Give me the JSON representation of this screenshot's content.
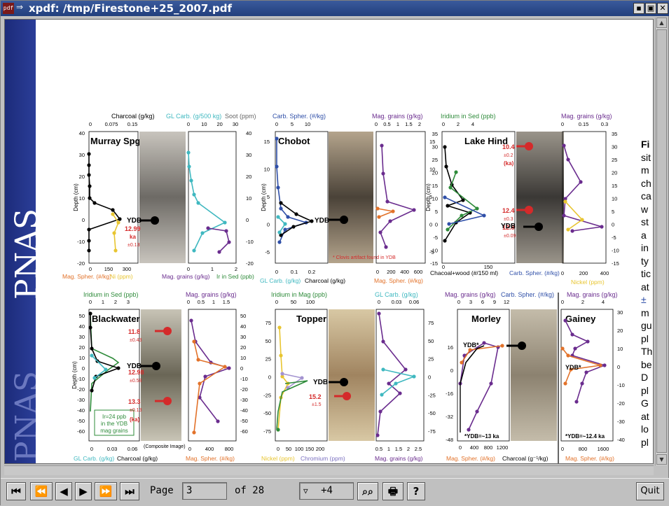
{
  "window": {
    "title": "xpdf: /tmp/Firestone+25_2007.pdf",
    "app_icon": "pdf",
    "buttons": {
      "iconify": "▪",
      "maximize": "▣",
      "close": "✕"
    }
  },
  "document": {
    "band_text_top": "PNAS",
    "band_text_bottom": "PNAS",
    "right_fragments": [
      "Fi",
      "sit",
      "m",
      "ch",
      "ca",
      "w",
      "st",
      "a",
      "in",
      "ty",
      "tic",
      "at",
      "±",
      "m",
      "gu",
      "pl",
      "Th",
      "be",
      "D",
      "pl",
      "G",
      "at",
      "lo",
      "pl"
    ],
    "panels": [
      {
        "name": "Murray Spgs",
        "top_axes": [
          "Charcoal (g/kg)",
          "GL Carb. (g/500 kg)",
          "Soot (ppm)"
        ],
        "top_ticks1": [
          "0",
          "0.075",
          "0.15"
        ],
        "top_ticks2": [
          "0",
          "10",
          "20",
          "30"
        ],
        "bottom_axes": [
          "Mag. Spher. (#/kg)",
          "Ni (ppm)",
          "Mag. grains (g/kg)",
          "Ir in Sed (ppb)"
        ],
        "bottom_ticks1": [
          "0",
          "150",
          "300"
        ],
        "bottom_ticks2": [
          "0",
          "1",
          "2"
        ],
        "left_ticks": [
          "40",
          "30",
          "20",
          "10",
          "0",
          "-10",
          "-20"
        ],
        "right_ticks": [
          "40",
          "30",
          "20",
          "10",
          "0",
          "-10",
          "-20"
        ],
        "ydb": "YDB",
        "age": "12.99",
        "age2": "ka",
        "age_err": "±0.13",
        "ylabel": "Depth (cm)"
      },
      {
        "name": "Chobot",
        "top_axes": [
          "Carb. Spher. (#/kg)",
          "Mag. grains (g/kg)"
        ],
        "top_ticks1": [
          "0",
          "5",
          "10"
        ],
        "top_ticks2": [
          "0",
          "0.5",
          "1",
          "1.5",
          "2"
        ],
        "bottom_axes": [
          "GL Carb. (g/kg)",
          "Charcoal (g/kg)",
          "Mag. Spher. (#/kg)"
        ],
        "bottom_ticks1": [
          "0",
          "0.1",
          "0.2"
        ],
        "bottom_ticks2": [
          "0",
          "200",
          "400",
          "600"
        ],
        "left_ticks": [
          "15",
          "10",
          "5",
          "0",
          "-5"
        ],
        "right_ticks": [
          "15",
          "10",
          "5",
          "0",
          "-5"
        ],
        "ydb": "YDB",
        "note": "Clovis artifact found in YDB",
        "ylabel": "Depth (cm)"
      },
      {
        "name": "Lake Hind",
        "top_axes": [
          "Iridium in Sed (ppb)",
          "Mag. grains (g/kg)"
        ],
        "top_ticks1": [
          "0",
          "2",
          "4"
        ],
        "top_ticks2": [
          "0",
          "0.15",
          "0.3"
        ],
        "bottom_axes": [
          "Chacoal+wood (#/150 ml)",
          "Carb. Spher. (#/kg)",
          "Nickel (ppm)"
        ],
        "bottom_ticks1": [
          "0",
          "150"
        ],
        "bottom_ticks2": [
          "0",
          "200",
          "400"
        ],
        "left_ticks": [
          "35",
          "30",
          "25",
          "20",
          "15",
          "10",
          "5",
          "0",
          "-5",
          "-10",
          "-15"
        ],
        "right_ticks": [
          "35",
          "30",
          "25",
          "20",
          "15",
          "10",
          "5",
          "0",
          "-5",
          "-10",
          "-15"
        ],
        "ydb": "YDB",
        "ages": [
          {
            "v": "10.4",
            "e": "±0.2",
            "u": "(ka)"
          },
          {
            "v": "12.4",
            "e": "±0.3",
            "u": ""
          },
          {
            "v": "12.8",
            "e": "±0.09",
            "u": ""
          }
        ],
        "ylabel": "Depth (cm)"
      },
      {
        "name": "Blackwater",
        "top_axes": [
          "Iridium in Sed (ppb)",
          "Mag. grains (g/kg)"
        ],
        "top_ticks1": [
          "0",
          "1",
          "2",
          "3"
        ],
        "top_ticks2": [
          "0",
          "0.5",
          "1",
          "1.5"
        ],
        "bottom_axes": [
          "GL Carb. (g/kg)",
          "Charcoal (g/kg)",
          "Mag. Spher. (#/kg)"
        ],
        "bottom_ticks1": [
          "0",
          "0.03",
          "0.06"
        ],
        "bottom_ticks2": [
          "0",
          "400",
          "800"
        ],
        "left_ticks": [
          "50",
          "40",
          "30",
          "20",
          "10",
          "0",
          "-10",
          "-20",
          "-30",
          "-40",
          "-50",
          "-60"
        ],
        "right_ticks": [
          "50",
          "40",
          "30",
          "20",
          "10",
          "0",
          "-10",
          "-20",
          "-30",
          "-40",
          "-50",
          "-60"
        ],
        "ydb": "YDB",
        "ages": [
          {
            "v": "11.8",
            "e": "±0.43"
          },
          {
            "v": "12.98",
            "e": "±0.58"
          },
          {
            "v": "13.3",
            "e": "±0.13"
          }
        ],
        "age_unit": "(ka)",
        "box": [
          "Ir=24 ppb",
          "in the YDB",
          "mag grains"
        ],
        "caption": "(Composite Image)",
        "ylabel": "Depth (cm)"
      },
      {
        "name": "Topper",
        "top_axes": [
          "Iridium in Mag (ppb)",
          "GL Carb. (g/kg)"
        ],
        "top_ticks1": [
          "0",
          "50",
          "100"
        ],
        "top_ticks2": [
          "0",
          "0.03",
          "0.06"
        ],
        "bottom_axes": [
          "Nickel (ppm)",
          "Chromium (ppm)",
          "Mag. grains (g/kg)"
        ],
        "bottom_ticks1": [
          "0",
          "50",
          "100",
          "150",
          "200"
        ],
        "bottom_ticks2": [
          "0.5",
          "1",
          "1.5",
          "2",
          "2.5"
        ],
        "left_ticks": [
          "75",
          "50",
          "25",
          "0",
          "-25",
          "-50",
          "-75"
        ],
        "right_ticks": [
          "75",
          "50",
          "25",
          "0",
          "-25",
          "-50",
          "-75"
        ],
        "ydb": "YDB",
        "age": "15.2",
        "age_err": "±1.5"
      },
      {
        "name": "Morley",
        "top_axes": [
          "Mag. grains (g/kg)",
          "Carb. Spher. (#/kg)"
        ],
        "top_ticks1": [
          "0",
          "3",
          "6",
          "9",
          "12"
        ],
        "bottom_axes": [
          "Mag. Spher. (#/kg)",
          "Charcoal (g⁻¹/kg)"
        ],
        "bottom_ticks1": [
          "0",
          "400",
          "800",
          "1200"
        ],
        "left_ticks": [
          "16",
          "0",
          "-16",
          "-32",
          "-48"
        ],
        "ydb": "YDB*",
        "note": "*YDB=~13 ka"
      },
      {
        "name": "Gainey",
        "top_axes": [
          "Mag. grains (g/kg)"
        ],
        "top_ticks1": [
          "0",
          "2",
          "4"
        ],
        "bottom_axes": [
          "Mag. Spher. (#/kg)"
        ],
        "bottom_ticks1": [
          "0",
          "800",
          "1600"
        ],
        "right_ticks": [
          "30",
          "20",
          "10",
          "0",
          "-10",
          "-20",
          "-30",
          "-40"
        ],
        "ydb": "YDB*",
        "note": "*YDB=~12.4 ka"
      }
    ]
  },
  "toolbar": {
    "first_label": "⏮",
    "back5_label": "⏪",
    "prev_label": "◀",
    "next_label": "▶",
    "fwd5_label": "⏩",
    "last_label": "⏭",
    "page_label": "Page",
    "page_value": "3",
    "of_label": "of 28",
    "zoom_value": "+4",
    "find_label": "🔍",
    "print_label": "🖶",
    "help_label": "?",
    "quit_label": "Quit"
  },
  "colors": {
    "pnas_blue": "#22348a",
    "ydb_red": "#d42a2a",
    "series_purple": "#6a2c8e",
    "series_orange": "#e2722a",
    "series_green": "#2e8b3a",
    "series_blue": "#2f4fa8",
    "series_cyan": "#3fb8c0",
    "series_yellow": "#e8c530"
  }
}
